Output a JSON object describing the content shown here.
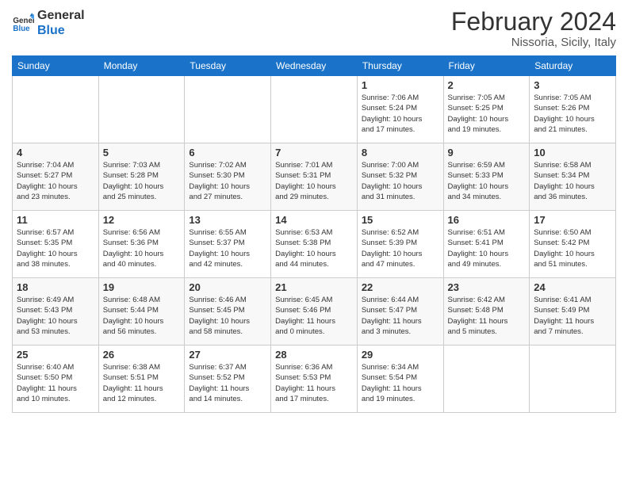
{
  "logo": {
    "line1": "General",
    "line2": "Blue"
  },
  "title": "February 2024",
  "subtitle": "Nissoria, Sicily, Italy",
  "days_of_week": [
    "Sunday",
    "Monday",
    "Tuesday",
    "Wednesday",
    "Thursday",
    "Friday",
    "Saturday"
  ],
  "weeks": [
    [
      {
        "day": "",
        "info": ""
      },
      {
        "day": "",
        "info": ""
      },
      {
        "day": "",
        "info": ""
      },
      {
        "day": "",
        "info": ""
      },
      {
        "day": "1",
        "info": "Sunrise: 7:06 AM\nSunset: 5:24 PM\nDaylight: 10 hours\nand 17 minutes."
      },
      {
        "day": "2",
        "info": "Sunrise: 7:05 AM\nSunset: 5:25 PM\nDaylight: 10 hours\nand 19 minutes."
      },
      {
        "day": "3",
        "info": "Sunrise: 7:05 AM\nSunset: 5:26 PM\nDaylight: 10 hours\nand 21 minutes."
      }
    ],
    [
      {
        "day": "4",
        "info": "Sunrise: 7:04 AM\nSunset: 5:27 PM\nDaylight: 10 hours\nand 23 minutes."
      },
      {
        "day": "5",
        "info": "Sunrise: 7:03 AM\nSunset: 5:28 PM\nDaylight: 10 hours\nand 25 minutes."
      },
      {
        "day": "6",
        "info": "Sunrise: 7:02 AM\nSunset: 5:30 PM\nDaylight: 10 hours\nand 27 minutes."
      },
      {
        "day": "7",
        "info": "Sunrise: 7:01 AM\nSunset: 5:31 PM\nDaylight: 10 hours\nand 29 minutes."
      },
      {
        "day": "8",
        "info": "Sunrise: 7:00 AM\nSunset: 5:32 PM\nDaylight: 10 hours\nand 31 minutes."
      },
      {
        "day": "9",
        "info": "Sunrise: 6:59 AM\nSunset: 5:33 PM\nDaylight: 10 hours\nand 34 minutes."
      },
      {
        "day": "10",
        "info": "Sunrise: 6:58 AM\nSunset: 5:34 PM\nDaylight: 10 hours\nand 36 minutes."
      }
    ],
    [
      {
        "day": "11",
        "info": "Sunrise: 6:57 AM\nSunset: 5:35 PM\nDaylight: 10 hours\nand 38 minutes."
      },
      {
        "day": "12",
        "info": "Sunrise: 6:56 AM\nSunset: 5:36 PM\nDaylight: 10 hours\nand 40 minutes."
      },
      {
        "day": "13",
        "info": "Sunrise: 6:55 AM\nSunset: 5:37 PM\nDaylight: 10 hours\nand 42 minutes."
      },
      {
        "day": "14",
        "info": "Sunrise: 6:53 AM\nSunset: 5:38 PM\nDaylight: 10 hours\nand 44 minutes."
      },
      {
        "day": "15",
        "info": "Sunrise: 6:52 AM\nSunset: 5:39 PM\nDaylight: 10 hours\nand 47 minutes."
      },
      {
        "day": "16",
        "info": "Sunrise: 6:51 AM\nSunset: 5:41 PM\nDaylight: 10 hours\nand 49 minutes."
      },
      {
        "day": "17",
        "info": "Sunrise: 6:50 AM\nSunset: 5:42 PM\nDaylight: 10 hours\nand 51 minutes."
      }
    ],
    [
      {
        "day": "18",
        "info": "Sunrise: 6:49 AM\nSunset: 5:43 PM\nDaylight: 10 hours\nand 53 minutes."
      },
      {
        "day": "19",
        "info": "Sunrise: 6:48 AM\nSunset: 5:44 PM\nDaylight: 10 hours\nand 56 minutes."
      },
      {
        "day": "20",
        "info": "Sunrise: 6:46 AM\nSunset: 5:45 PM\nDaylight: 10 hours\nand 58 minutes."
      },
      {
        "day": "21",
        "info": "Sunrise: 6:45 AM\nSunset: 5:46 PM\nDaylight: 11 hours\nand 0 minutes."
      },
      {
        "day": "22",
        "info": "Sunrise: 6:44 AM\nSunset: 5:47 PM\nDaylight: 11 hours\nand 3 minutes."
      },
      {
        "day": "23",
        "info": "Sunrise: 6:42 AM\nSunset: 5:48 PM\nDaylight: 11 hours\nand 5 minutes."
      },
      {
        "day": "24",
        "info": "Sunrise: 6:41 AM\nSunset: 5:49 PM\nDaylight: 11 hours\nand 7 minutes."
      }
    ],
    [
      {
        "day": "25",
        "info": "Sunrise: 6:40 AM\nSunset: 5:50 PM\nDaylight: 11 hours\nand 10 minutes."
      },
      {
        "day": "26",
        "info": "Sunrise: 6:38 AM\nSunset: 5:51 PM\nDaylight: 11 hours\nand 12 minutes."
      },
      {
        "day": "27",
        "info": "Sunrise: 6:37 AM\nSunset: 5:52 PM\nDaylight: 11 hours\nand 14 minutes."
      },
      {
        "day": "28",
        "info": "Sunrise: 6:36 AM\nSunset: 5:53 PM\nDaylight: 11 hours\nand 17 minutes."
      },
      {
        "day": "29",
        "info": "Sunrise: 6:34 AM\nSunset: 5:54 PM\nDaylight: 11 hours\nand 19 minutes."
      },
      {
        "day": "",
        "info": ""
      },
      {
        "day": "",
        "info": ""
      }
    ]
  ]
}
